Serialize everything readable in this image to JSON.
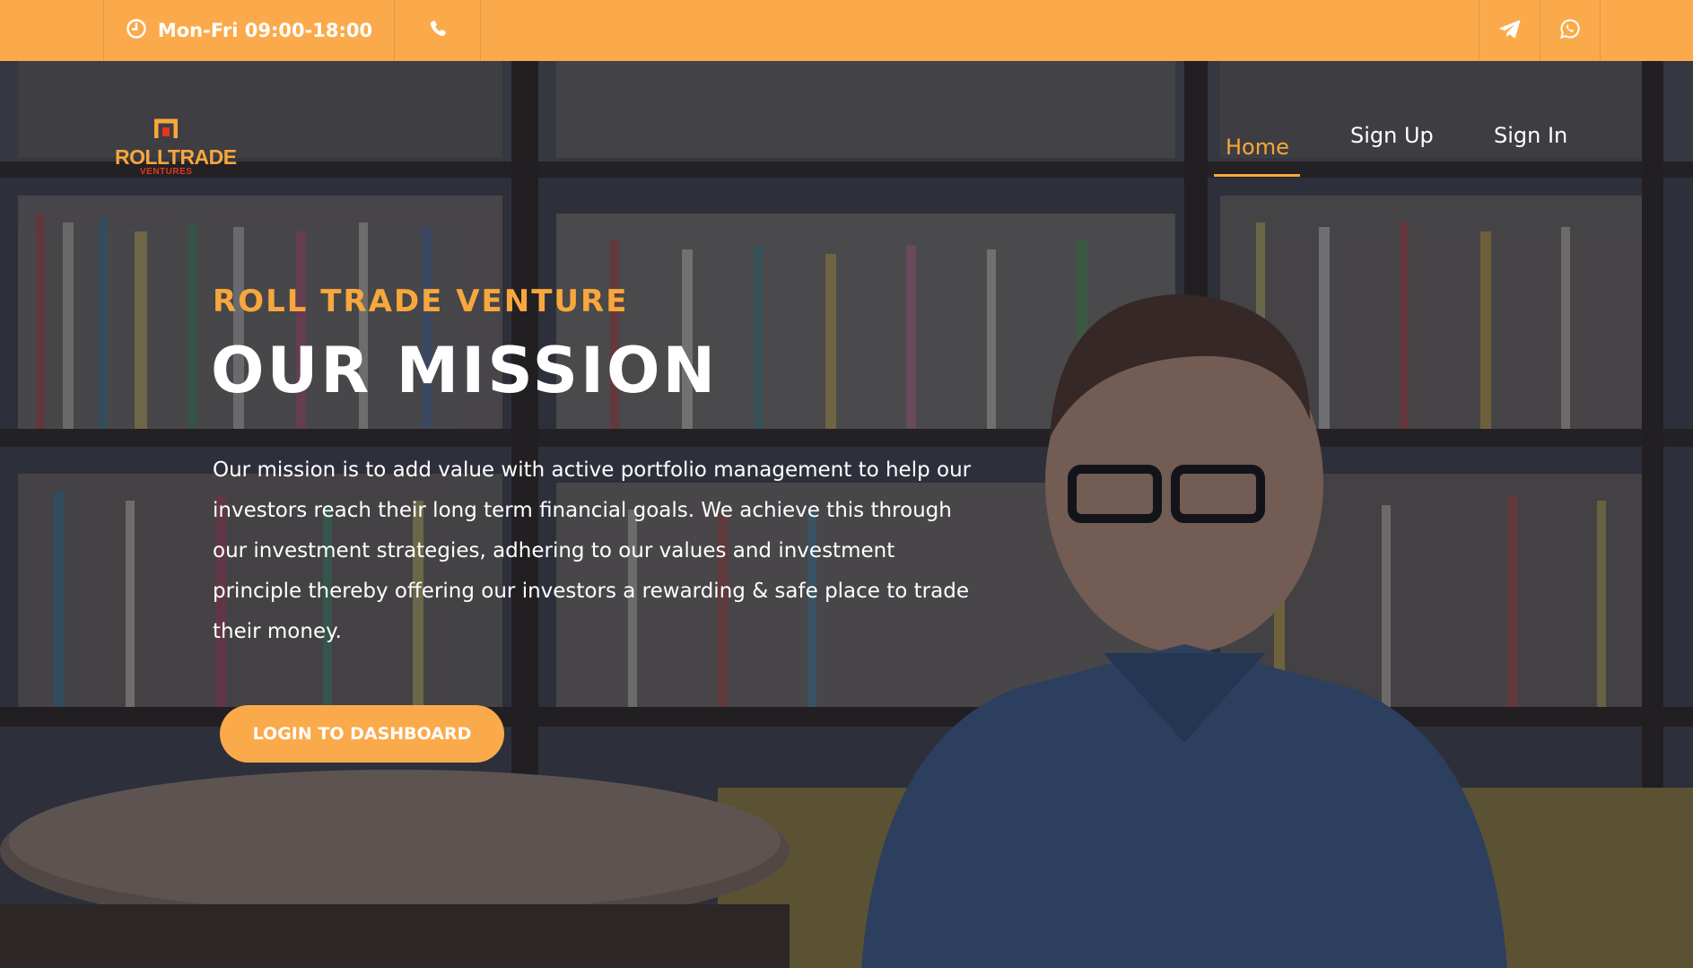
{
  "topbar": {
    "hours": "Mon-Fri 09:00-18:00",
    "icons": [
      "clock-icon",
      "phone-icon",
      "telegram-icon",
      "whatsapp-icon"
    ]
  },
  "brand": {
    "name": "ROLLTRADE",
    "sub": "VENTURES",
    "color_primary": "#f7a73c",
    "color_secondary": "#e5361f"
  },
  "nav": {
    "items": [
      {
        "label": "Home",
        "active": true
      },
      {
        "label": "Sign Up",
        "active": false
      },
      {
        "label": "Sign In",
        "active": false
      }
    ]
  },
  "hero": {
    "eyebrow": "ROLL TRADE VENTURE",
    "title": "OUR MISSION",
    "body": "Our mission is to add value with active portfolio management to help our investors reach their long term financial goals. We achieve this through our investment strategies, adhering to our values and investment principle thereby offering our investors a rewarding & safe place to trade their money.",
    "cta": "LOGIN TO DASHBOARD"
  },
  "colors": {
    "accent": "#fbaa4b",
    "text_light": "#ffffff"
  }
}
